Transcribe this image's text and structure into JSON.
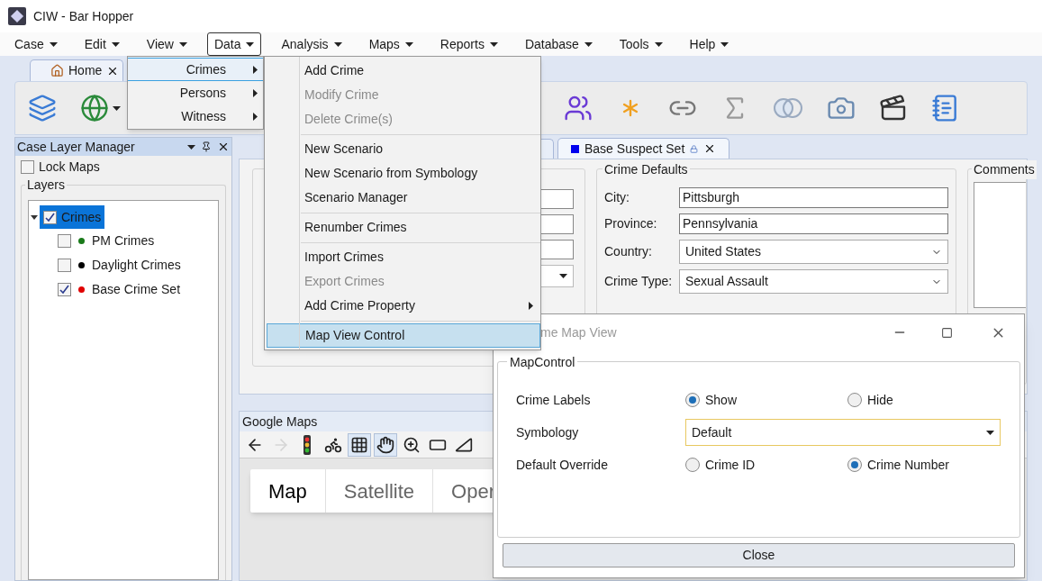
{
  "window": {
    "title": "CIW - Bar Hopper"
  },
  "menu_bar": [
    {
      "label": "Case",
      "selected": false
    },
    {
      "label": "Edit",
      "selected": false
    },
    {
      "label": "View",
      "selected": false
    },
    {
      "label": "Data",
      "selected": true
    },
    {
      "label": "Analysis",
      "selected": false
    },
    {
      "label": "Maps",
      "selected": false
    },
    {
      "label": "Reports",
      "selected": false
    },
    {
      "label": "Database",
      "selected": false
    },
    {
      "label": "Tools",
      "selected": false
    },
    {
      "label": "Help",
      "selected": false
    }
  ],
  "home_tab": {
    "label": "Home"
  },
  "toolbar": [
    {
      "kind": "layers"
    },
    {
      "kind": "globe"
    },
    {
      "kind": "people"
    },
    {
      "kind": "asterisk"
    },
    {
      "kind": "link"
    },
    {
      "kind": "sigma"
    },
    {
      "kind": "venn"
    },
    {
      "kind": "camera"
    },
    {
      "kind": "clapper"
    },
    {
      "kind": "notebook"
    }
  ],
  "layer_manager": {
    "title": "Case Layer Manager",
    "lock_maps": {
      "label": "Lock Maps",
      "checked": false
    },
    "group_label": "Layers",
    "tree": [
      {
        "label": "Crimes",
        "checked": true,
        "selected": true,
        "expanded": true,
        "children": [
          {
            "label": "PM Crimes",
            "checked": false,
            "color": "#1a7a1a"
          },
          {
            "label": "Daylight Crimes",
            "checked": false,
            "color": "#000000"
          },
          {
            "label": "Base Crime Set",
            "checked": true,
            "color": "#e00000"
          }
        ]
      }
    ]
  },
  "document_tabs": [
    {
      "label": "Base Suspect Set",
      "selected": true,
      "color": "#0000ee"
    }
  ],
  "crime_defaults": {
    "title": "Crime Defaults",
    "fields": [
      {
        "label": "City:",
        "value": "Pittsburgh",
        "kind": "text"
      },
      {
        "label": "Province:",
        "value": "Pennsylvania",
        "kind": "text"
      },
      {
        "label": "Country:",
        "value": "United States",
        "kind": "dropdown"
      },
      {
        "label": "Crime Type:",
        "value": "Sexual Assault",
        "kind": "dropdown"
      }
    ]
  },
  "comments": {
    "title": "Comments"
  },
  "map_panel": {
    "title": "Google Maps",
    "tools": [
      {
        "kind": "back",
        "disabled": false,
        "pressed": false
      },
      {
        "kind": "forward",
        "disabled": true,
        "pressed": false
      },
      {
        "kind": "traffic",
        "disabled": false,
        "pressed": false
      },
      {
        "kind": "bike",
        "disabled": false,
        "pressed": false
      },
      {
        "kind": "overlay",
        "disabled": false,
        "pressed": true
      },
      {
        "kind": "hand",
        "disabled": false,
        "pressed": true
      },
      {
        "kind": "zoom",
        "disabled": false,
        "pressed": false
      },
      {
        "kind": "select",
        "disabled": false,
        "pressed": false
      },
      {
        "kind": "ruler",
        "disabled": false,
        "pressed": false
      }
    ],
    "map_types": [
      {
        "label": "Map",
        "selected": true
      },
      {
        "label": "Satellite",
        "selected": false
      },
      {
        "label": "Oper",
        "selected": false
      }
    ]
  },
  "data_menu": [
    {
      "label": "Crimes",
      "selected": true
    },
    {
      "label": "Persons",
      "selected": false
    },
    {
      "label": "Witness",
      "selected": false
    }
  ],
  "crimes_submenu": [
    [
      {
        "label": "Add Crime",
        "disabled": false,
        "selected": false,
        "has_submenu": false
      },
      {
        "label": "Modify Crime",
        "disabled": true,
        "selected": false,
        "has_submenu": false
      },
      {
        "label": "Delete Crime(s)",
        "disabled": true,
        "selected": false,
        "has_submenu": false
      }
    ],
    [
      {
        "label": "New Scenario",
        "disabled": false,
        "selected": false,
        "has_submenu": false
      },
      {
        "label": "New Scenario from Symbology",
        "disabled": false,
        "selected": false,
        "has_submenu": false
      },
      {
        "label": "Scenario Manager",
        "disabled": false,
        "selected": false,
        "has_submenu": false
      }
    ],
    [
      {
        "label": "Renumber Crimes",
        "disabled": false,
        "selected": false,
        "has_submenu": false
      }
    ],
    [
      {
        "label": "Import Crimes",
        "disabled": false,
        "selected": false,
        "has_submenu": false
      },
      {
        "label": "Export Crimes",
        "disabled": true,
        "selected": false,
        "has_submenu": false
      },
      {
        "label": "Add Crime Property",
        "disabled": false,
        "selected": false,
        "has_submenu": true
      }
    ],
    [
      {
        "label": "Map View Control",
        "disabled": false,
        "selected": true,
        "has_submenu": false
      }
    ]
  ],
  "dialog": {
    "title": "me Map View",
    "group_title": "MapControl",
    "rows": [
      {
        "label": "Crime Labels",
        "kind": "radio",
        "options": [
          {
            "label": "Show",
            "selected": true
          },
          {
            "label": "Hide",
            "selected": false
          }
        ]
      },
      {
        "label": "Symbology",
        "kind": "dropdown",
        "value": "Default"
      },
      {
        "label": "Default Override",
        "kind": "radio",
        "options": [
          {
            "label": "Crime ID",
            "selected": false
          },
          {
            "label": "Crime Number",
            "selected": true
          }
        ]
      }
    ],
    "close_button": "Close"
  }
}
